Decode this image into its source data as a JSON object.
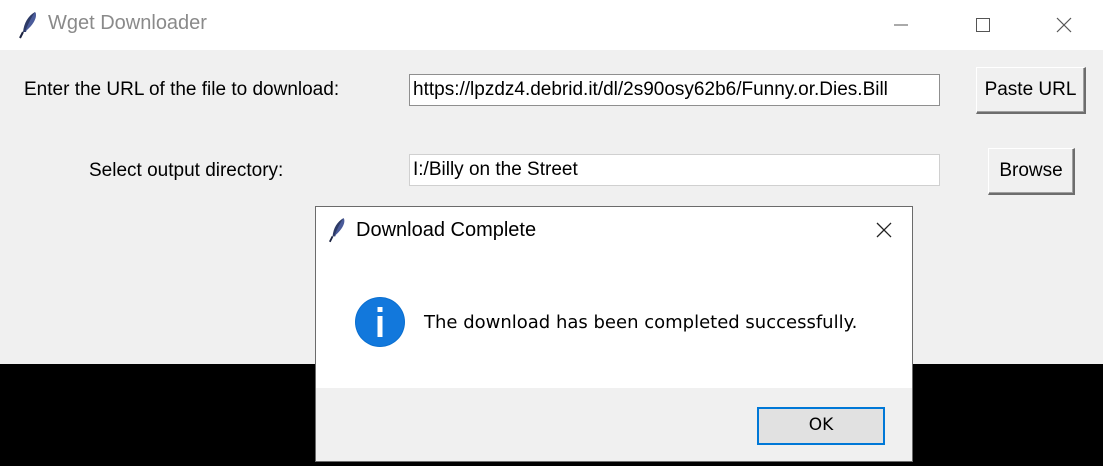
{
  "window": {
    "title": "Wget Downloader",
    "icon": "feather-icon"
  },
  "form": {
    "url_label": "Enter the URL of the file to download:",
    "url_value": "https://lpzdz4.debrid.it/dl/2s90osy62b6/Funny.or.Dies.Bill",
    "paste_button": "Paste URL",
    "dir_label": "Select output directory:",
    "dir_value": "I:/Billy on the Street",
    "browse_button": "Browse"
  },
  "dialog": {
    "title": "Download Complete",
    "icon": "info-icon",
    "message": "The download has been completed successfully.",
    "ok_button": "OK",
    "accent_color": "#0078d7"
  }
}
